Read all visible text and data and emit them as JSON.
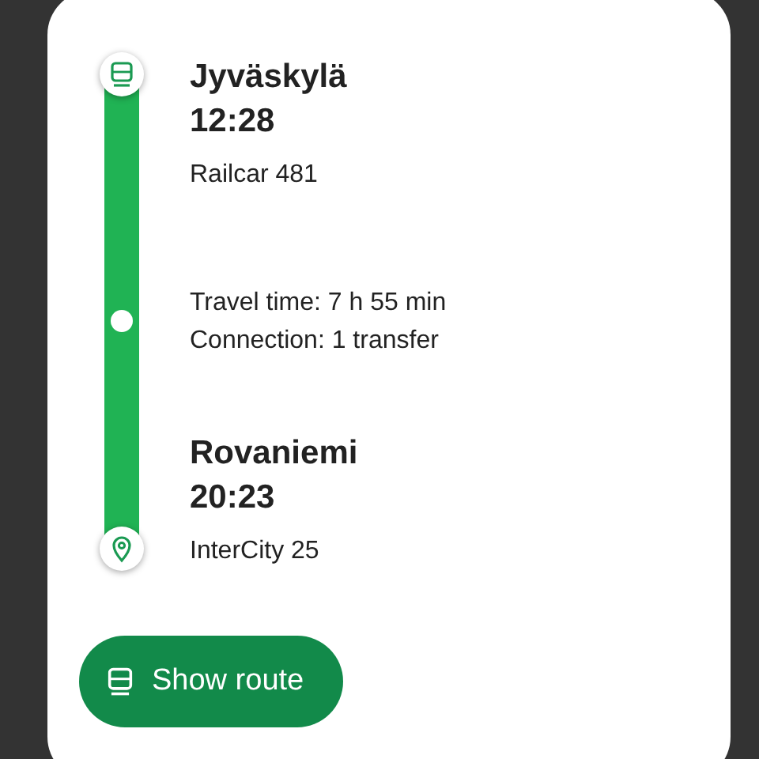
{
  "origin": {
    "station": "Jyväskylä",
    "time": "12:28",
    "train": "Railcar 481"
  },
  "summary": [
    "Travel time: 7 h 55 min",
    "Connection: 1 transfer"
  ],
  "destination": {
    "station": "Rovaniemi",
    "time": "20:23",
    "train": "InterCity 25"
  },
  "button": {
    "label": "Show route"
  }
}
